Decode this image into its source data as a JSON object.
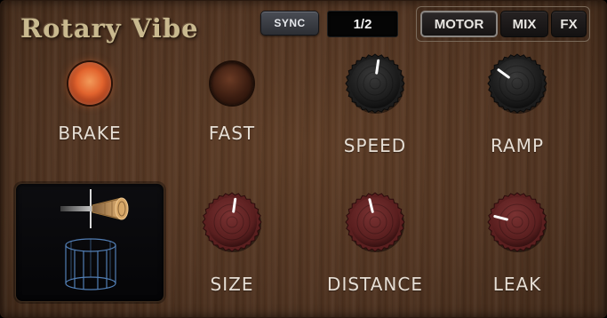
{
  "header": {
    "title": "Rotary Vibe",
    "sync_label": "SYNC",
    "rate_value": "1/2"
  },
  "tabs": [
    {
      "label": "MOTOR",
      "active": true
    },
    {
      "label": "MIX",
      "active": false
    },
    {
      "label": "FX",
      "active": false
    }
  ],
  "switches": {
    "brake": {
      "label": "BRAKE",
      "lit": true
    },
    "fast": {
      "label": "FAST",
      "lit": false
    }
  },
  "knobs": {
    "speed": {
      "label": "SPEED",
      "value": 0.53,
      "style": "black"
    },
    "ramp": {
      "label": "RAMP",
      "value": 0.3,
      "style": "black"
    },
    "size": {
      "label": "SIZE",
      "value": 0.53,
      "style": "red"
    },
    "distance": {
      "label": "DISTANCE",
      "value": 0.45,
      "style": "red"
    },
    "leak": {
      "label": "LEAK",
      "value": 0.22,
      "style": "red"
    }
  },
  "colors": {
    "led_on": "#e2642e",
    "knob_black": "#1c1c1c",
    "knob_red": "#5a1f1f",
    "pointer": "#ffffff",
    "wireframe": "#5a8bc7"
  },
  "icons": {
    "rotor_display": "rotor-speaker-wireframe-icon"
  }
}
